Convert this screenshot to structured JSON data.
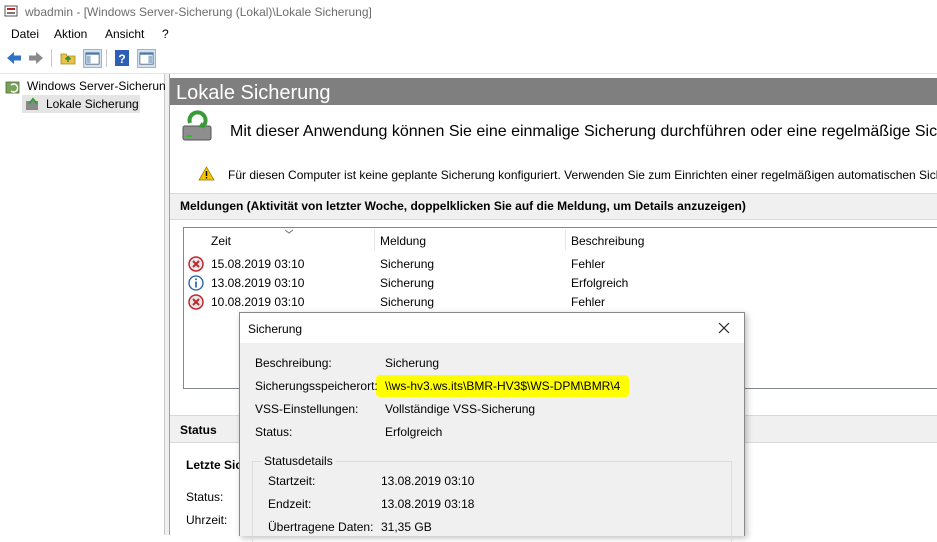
{
  "window": {
    "title": "wbadmin - [Windows Server-Sicherung (Lokal)\\Lokale Sicherung]"
  },
  "menu": [
    "Datei",
    "Aktion",
    "Ansicht",
    "?"
  ],
  "toolbar": {
    "buttons": [
      "back-arrow-icon",
      "forward-arrow-icon",
      "folder-up-icon",
      "show-hide-tree-icon",
      "help-icon",
      "properties-pane-icon"
    ]
  },
  "tree": {
    "root_label": "Windows Server-Sicherun",
    "child_label": "Lokale Sicherung"
  },
  "content": {
    "header": "Lokale Sicherung",
    "intro": "Mit dieser Anwendung können Sie eine einmalige Sicherung durchführen oder eine regelmäßige Siche",
    "warning": "Für diesen Computer ist keine geplante Sicherung konfiguriert. Verwenden Sie zum Einrichten einer regelmäßigen automatischen Siche",
    "messages_title": "Meldungen (Aktivität von letzter Woche, doppelklicken Sie auf die Meldung, um Details anzuzeigen)",
    "columns": [
      "Zeit",
      "Meldung",
      "Beschreibung"
    ],
    "rows": [
      {
        "status": "error",
        "time": "15.08.2019 03:10",
        "message": "Sicherung",
        "description": "Fehler"
      },
      {
        "status": "info",
        "time": "13.08.2019 03:10",
        "message": "Sicherung",
        "description": "Erfolgreich"
      },
      {
        "status": "error",
        "time": "10.08.2019 03:10",
        "message": "Sicherung",
        "description": "Fehler"
      }
    ],
    "status_title": "Status",
    "last_backup_label": "Letzte Sic",
    "status_label": "Status:",
    "time_label": "Uhrzeit:"
  },
  "dialog": {
    "title": "Sicherung",
    "fields": [
      {
        "label": "Beschreibung:",
        "value": "Sicherung"
      },
      {
        "label": "Sicherungsspeicherort:",
        "value": "\\\\ws-hv3.ws.its\\BMR-HV3$\\WS-DPM\\BMR\\4"
      },
      {
        "label": "VSS-Einstellungen:",
        "value": "Vollständige VSS-Sicherung"
      },
      {
        "label": "Status:",
        "value": "Erfolgreich"
      }
    ],
    "status_details": {
      "legend": "Statusdetails",
      "fields": [
        {
          "label": "Startzeit:",
          "value": "13.08.2019 03:10"
        },
        {
          "label": "Endzeit:",
          "value": "13.08.2019 03:18"
        },
        {
          "label": "Übertragene Daten:",
          "value": "31,35 GB"
        }
      ]
    },
    "highlight_color": "#ffff00"
  },
  "colors": {
    "header_bg": "#7f7f7f",
    "error_red": "#d13438",
    "info_blue": "#1e5aa8",
    "warn_yellow": "#f5c400"
  }
}
